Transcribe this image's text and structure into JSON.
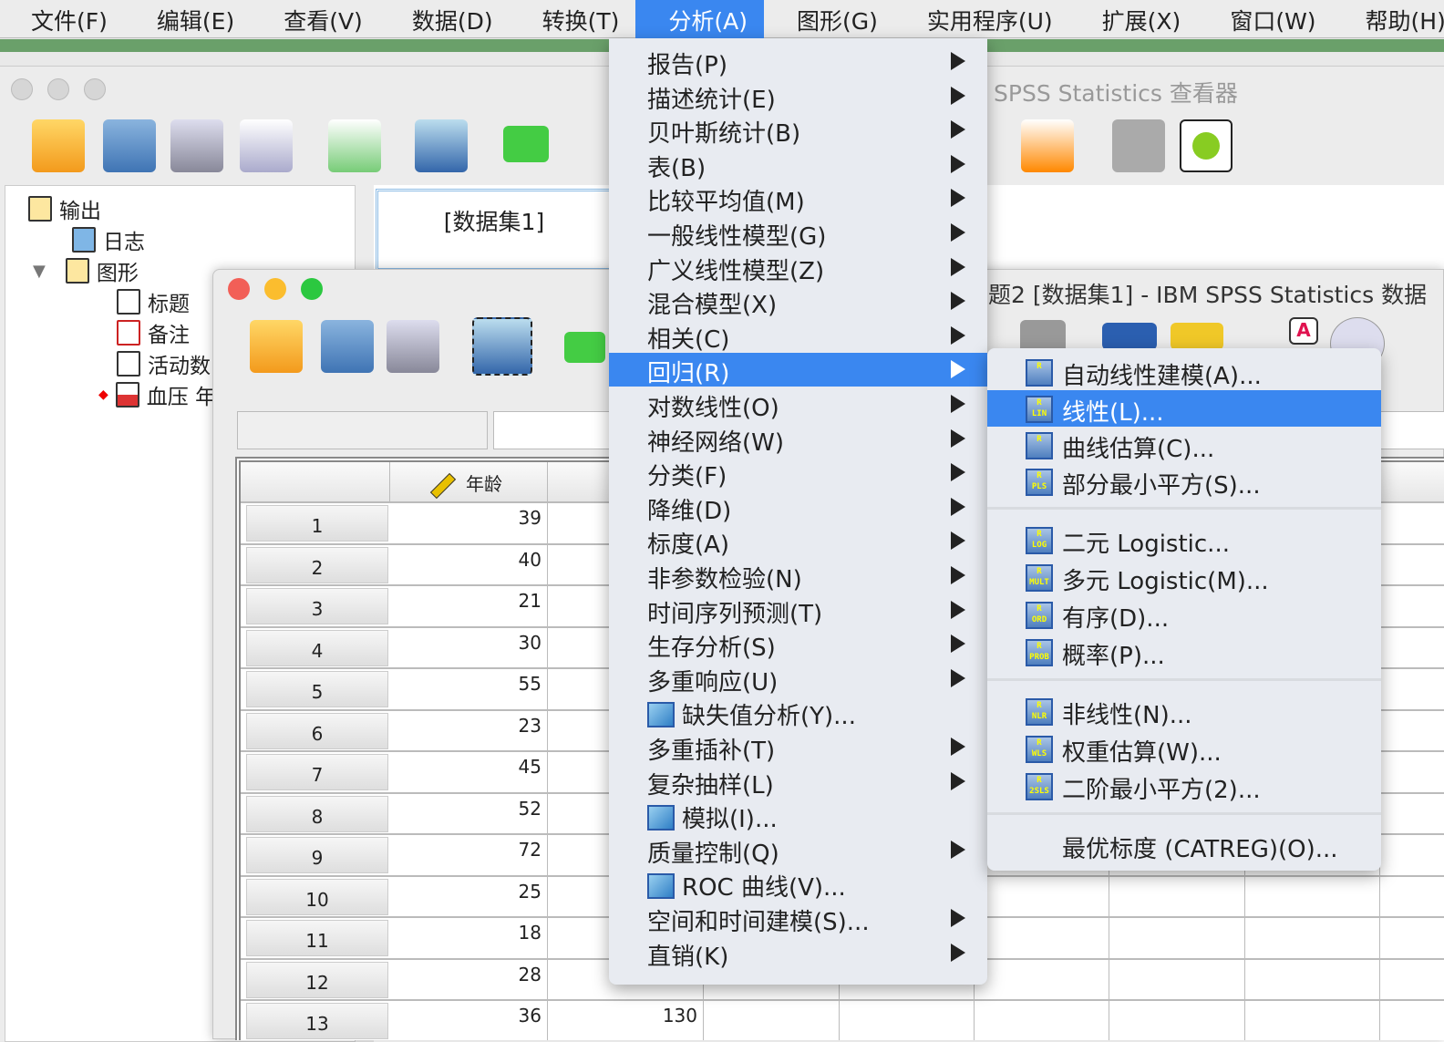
{
  "menubar": {
    "items": [
      "文件(F)",
      "编辑(E)",
      "查看(V)",
      "数据(D)",
      "转换(T)",
      "分析(A)",
      "图形(G)",
      "实用程序(U)",
      "扩展(X)",
      "窗口(W)",
      "帮助(H)"
    ],
    "active": "分析(A)"
  },
  "viewer": {
    "title": "SPSS Statistics 查看器",
    "dataset_label": "[数据集1]",
    "tree": [
      "输出",
      "日志",
      "图形",
      "标题",
      "备注",
      "活动数",
      "血压 年"
    ]
  },
  "editor": {
    "title": "题2 [数据集1] - IBM SPSS Statistics 数据",
    "columns": [
      "年龄"
    ],
    "rows": [
      {
        "n": "1",
        "age": "39"
      },
      {
        "n": "2",
        "age": "40"
      },
      {
        "n": "3",
        "age": "21"
      },
      {
        "n": "4",
        "age": "30"
      },
      {
        "n": "5",
        "age": "55"
      },
      {
        "n": "6",
        "age": "23"
      },
      {
        "n": "7",
        "age": "45"
      },
      {
        "n": "8",
        "age": "52"
      },
      {
        "n": "9",
        "age": "72"
      },
      {
        "n": "10",
        "age": "25"
      },
      {
        "n": "11",
        "age": "18"
      },
      {
        "n": "12",
        "age": "28"
      },
      {
        "n": "13",
        "age": "36",
        "col2": "130"
      }
    ]
  },
  "analyze_menu": {
    "items": [
      {
        "label": "报告(P)",
        "sub": true
      },
      {
        "label": "描述统计(E)",
        "sub": true
      },
      {
        "label": "贝叶斯统计(B)",
        "sub": true
      },
      {
        "label": "表(B)",
        "sub": true
      },
      {
        "label": "比较平均值(M)",
        "sub": true
      },
      {
        "label": "一般线性模型(G)",
        "sub": true
      },
      {
        "label": "广义线性模型(Z)",
        "sub": true
      },
      {
        "label": "混合模型(X)",
        "sub": true
      },
      {
        "label": "相关(C)",
        "sub": true
      },
      {
        "label": "回归(R)",
        "sub": true,
        "selected": true
      },
      {
        "label": "对数线性(O)",
        "sub": true
      },
      {
        "label": "神经网络(W)",
        "sub": true
      },
      {
        "label": "分类(F)",
        "sub": true
      },
      {
        "label": "降维(D)",
        "sub": true
      },
      {
        "label": "标度(A)",
        "sub": true
      },
      {
        "label": "非参数检验(N)",
        "sub": true
      },
      {
        "label": "时间序列预测(T)",
        "sub": true
      },
      {
        "label": "生存分析(S)",
        "sub": true
      },
      {
        "label": "多重响应(U)",
        "sub": true
      },
      {
        "label": "缺失值分析(Y)...",
        "icon": "missing-value-icon"
      },
      {
        "label": "多重插补(T)",
        "sub": true
      },
      {
        "label": "复杂抽样(L)",
        "sub": true
      },
      {
        "label": "模拟(I)...",
        "icon": "simulation-icon"
      },
      {
        "label": "质量控制(Q)",
        "sub": true
      },
      {
        "label": "ROC 曲线(V)...",
        "icon": "roc-curve-icon"
      },
      {
        "label": "空间和时间建模(S)...",
        "sub": true
      },
      {
        "label": "直销(K)",
        "sub": true
      }
    ]
  },
  "regression_submenu": {
    "groups": [
      [
        {
          "label": "自动线性建模(A)...",
          "badge": ""
        },
        {
          "label": "线性(L)...",
          "badge": "LIN",
          "selected": true
        },
        {
          "label": "曲线估算(C)...",
          "badge": ""
        },
        {
          "label": "部分最小平方(S)...",
          "badge": "PLS"
        }
      ],
      [
        {
          "label": "二元 Logistic...",
          "badge": "LOG"
        },
        {
          "label": "多元 Logistic(M)...",
          "badge": "MULT"
        },
        {
          "label": "有序(D)...",
          "badge": "ORD"
        },
        {
          "label": "概率(P)...",
          "badge": "PROB"
        }
      ],
      [
        {
          "label": "非线性(N)...",
          "badge": "NLR"
        },
        {
          "label": "权重估算(W)...",
          "badge": "WLS"
        },
        {
          "label": "二阶最小平方(2)...",
          "badge": "2SLS"
        }
      ],
      [
        {
          "label": "最优标度 (CATREG)(O)..."
        }
      ]
    ]
  },
  "colors": {
    "accent": "#3a87f0",
    "menu_bg": "#e8ebf1"
  }
}
